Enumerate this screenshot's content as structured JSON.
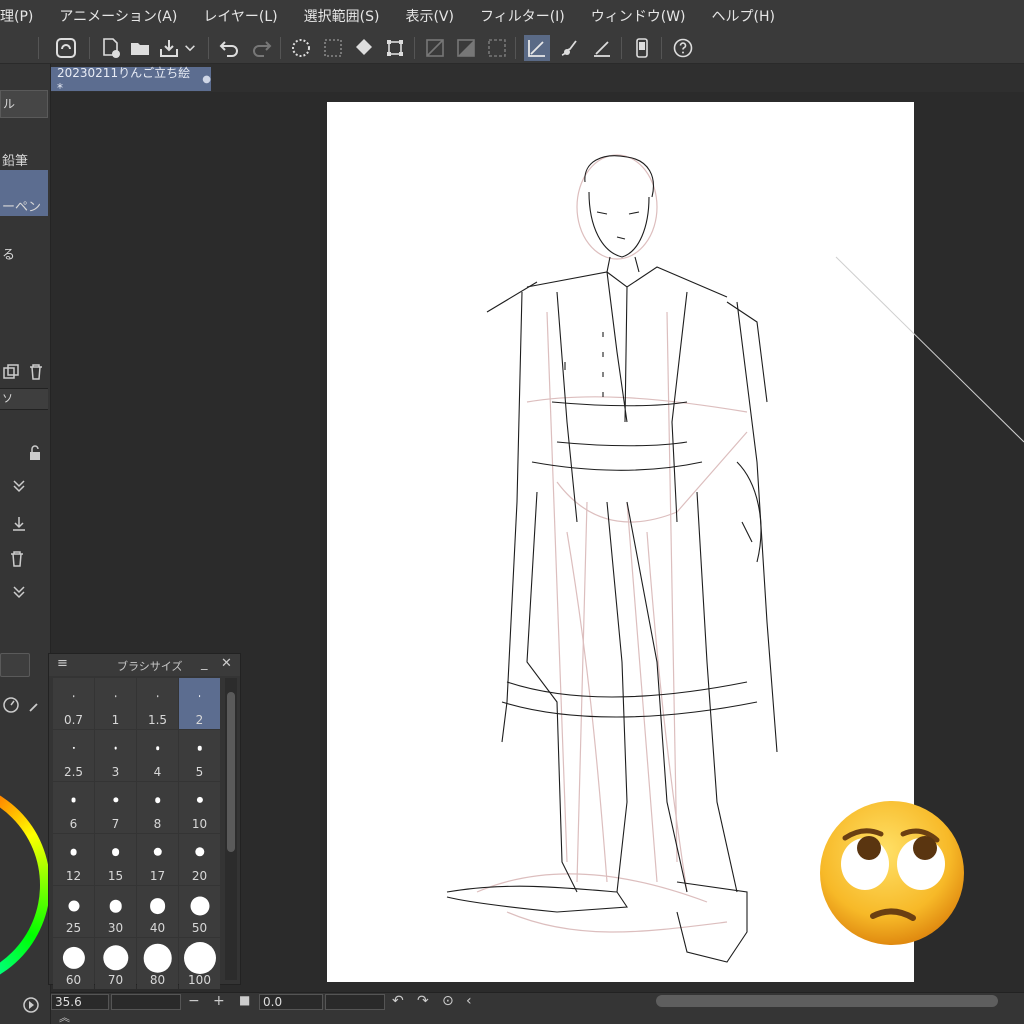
{
  "menu": [
    "管理(P)",
    "アニメーション(A)",
    "レイヤー(L)",
    "選択範囲(S)",
    "表示(V)",
    "フィルター(I)",
    "ウィンドウ(W)",
    "ヘルプ(H)"
  ],
  "document_tab": {
    "title": "20230211りんご立ち絵*",
    "modified_marker": "●"
  },
  "left_panel": {
    "tab_label": "ル",
    "items": [
      "鉛筆",
      "ーペン",
      "る"
    ],
    "layer_tab": "ソ"
  },
  "brush_palette": {
    "title": "ブラシサイズ",
    "sizes": [
      "0.7",
      "1",
      "1.5",
      "2",
      "2.5",
      "3",
      "4",
      "5",
      "6",
      "7",
      "8",
      "10",
      "12",
      "15",
      "17",
      "20",
      "25",
      "30",
      "40",
      "50",
      "60",
      "70",
      "80",
      "100"
    ],
    "selected": "2"
  },
  "status_bar": {
    "zoom": "35.6",
    "minus": "−",
    "plus": "+",
    "rotation": "0.0"
  },
  "colors": {
    "accent": "#5c6d90",
    "background": "#2b2b2b",
    "panel": "#353535"
  },
  "icons": [
    "cloud-logo-icon",
    "new-file-icon",
    "open-folder-icon",
    "save-icon",
    "undo-icon",
    "redo-icon",
    "clear-icon",
    "fill-icon",
    "transform-icon",
    "ruler-icon",
    "snap-icon",
    "help-icon"
  ]
}
